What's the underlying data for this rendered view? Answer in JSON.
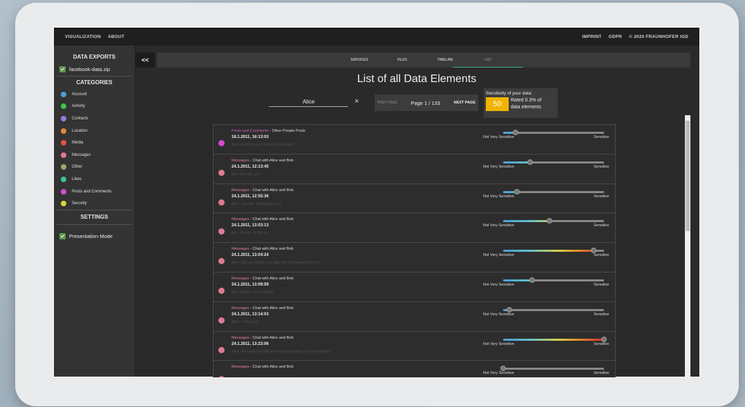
{
  "topnav": {
    "left": [
      "VISUALIZATION",
      "ABOUT"
    ],
    "right": [
      "IMPRINT",
      "GDPR",
      "© 2020 FRAUNHOFER IGD"
    ]
  },
  "sidebar": {
    "data_exports_title": "DATA EXPORTS",
    "export_file": "facebook-data.zip",
    "categories_title": "CATEGORIES",
    "categories": [
      {
        "label": "Account",
        "color": "#4a9fd6"
      },
      {
        "label": "Activity",
        "color": "#3fc44a"
      },
      {
        "label": "Contacts",
        "color": "#9a7be0"
      },
      {
        "label": "Location",
        "color": "#e0893a"
      },
      {
        "label": "Media",
        "color": "#e0553a"
      },
      {
        "label": "Messages",
        "color": "#e07a92"
      },
      {
        "label": "Other",
        "color": "#a0a86a"
      },
      {
        "label": "Likes",
        "color": "#3ac49a"
      },
      {
        "label": "Posts and Comments",
        "color": "#d64ad0"
      },
      {
        "label": "Security",
        "color": "#d6d63a"
      }
    ],
    "settings_title": "SETTINGS",
    "presentation_mode": "Presentation Mode"
  },
  "collapse_label": "<<",
  "tabs": [
    "SERVICES",
    "FILES",
    "TIMELINE",
    "LIST"
  ],
  "page_title": "List of all Data Elements",
  "search": {
    "value": "Alice"
  },
  "clear_icon": "×",
  "pager": {
    "prev": "PREV PAGE",
    "info": "Page 1 / 133",
    "next": "NEXT PAGE"
  },
  "sensitivity": {
    "title": "Sensitivity of your data:",
    "score": "50",
    "rated_line1": "Rated 0.3% of",
    "rated_line2": "data elements"
  },
  "slider_labels": {
    "low": "Not Very Sensitive",
    "high": "Sensitive"
  },
  "items": [
    {
      "category": "Posts and Comments",
      "subtitle": " - Other People Posts",
      "date": "18.1.2011, 16:13:03",
      "preview": "Alice posted to your Timeline: Hello Bob!",
      "dot": "#d64ad0",
      "sensitivity": 0.12
    },
    {
      "category": "Messages",
      "subtitle": " - Chat with Alice and Bob",
      "date": "24.1.2011, 12:13:45",
      "preview": "Bob: How are you?",
      "dot": "#e07a92",
      "sensitivity": 0.27
    },
    {
      "category": "Messages",
      "subtitle": " - Chat with Alice and Bob",
      "date": "24.1.2011, 12:55:36",
      "preview": "Alice: I am fine, what about you?",
      "dot": "#e07a92",
      "sensitivity": 0.14
    },
    {
      "category": "Messages",
      "subtitle": " - Chat with Alice and Bob",
      "date": "24.1.2011, 13:03:13",
      "preview": "Bob: Thanks, its fine too",
      "dot": "#e07a92",
      "sensitivity": 0.46
    },
    {
      "category": "Messages",
      "subtitle": " - Chat with Alice and Bob",
      "date": "24.1.2011, 13:04:24",
      "preview": "Alice: Did you inspect your data with TransparencyVis yet?",
      "dot": "#e07a92",
      "sensitivity": 0.9
    },
    {
      "category": "Messages",
      "subtitle": " - Chat with Alice and Bob",
      "date": "24.1.2011, 13:09:59",
      "preview": "Bob: Not yet, but I intend to",
      "dot": "#e07a92",
      "sensitivity": 0.29
    },
    {
      "category": "Messages",
      "subtitle": " - Chat with Alice and Bob",
      "date": "24.1.2011, 13:14:03",
      "preview": "Alice: Thats great!",
      "dot": "#e07a92",
      "sensitivity": 0.06
    },
    {
      "category": "Messages",
      "subtitle": " - Chat with Alice and Bob",
      "date": "24.1.2011, 13:23:06",
      "preview": "Alice: We could also add both our data exports, if you would like?",
      "dot": "#e07a92",
      "sensitivity": 1.0
    },
    {
      "category": "Messages",
      "subtitle": " - Chat with Alice and Bob",
      "date": "",
      "preview": "",
      "dot": "#e07a92",
      "sensitivity": 0.0
    }
  ]
}
